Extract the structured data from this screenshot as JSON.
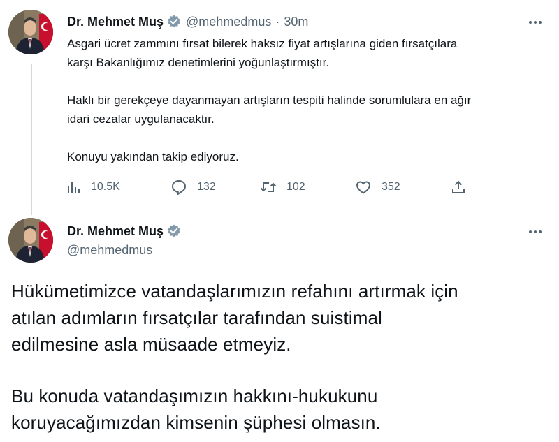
{
  "tweet1": {
    "author": {
      "name": "Dr. Mehmet Muş",
      "handle": "@mehmedmus",
      "verified": true
    },
    "separator": "·",
    "time": "30m",
    "paragraphs": [
      [
        "Asgari ücret zammını fırsat bilerek haksız fiyat artışlarına giden fırsatçılara",
        "karşı Bakanlığımız denetimlerini yoğunlaştırmıştır."
      ],
      [
        "Haklı bir gerekçeye dayanmayan artışların tespiti halinde sorumlulara en ağır",
        "idari cezalar uygulanacaktır."
      ],
      [
        "Konuyu yakından takip ediyoruz."
      ]
    ],
    "stats": {
      "views": "10.5K",
      "replies": "132",
      "retweets": "102",
      "likes": "352"
    },
    "icons": {
      "views": "views-chart-icon",
      "reply": "reply-bubble-icon",
      "retweet": "retweet-arrows-icon",
      "like": "heart-icon",
      "share": "share-upload-icon",
      "more": "more-dots-icon"
    }
  },
  "tweet2": {
    "author": {
      "name": "Dr. Mehmet Muş",
      "handle": "@mehmedmus",
      "verified": true
    },
    "paragraphs": [
      [
        "Hükümetimizce vatandaşlarımızın refahını artırmak için",
        "atılan adımların fırsatçılar tarafından suistimal",
        "edilmesine asla müsaade etmeyiz."
      ],
      [
        "Bu konuda vatandaşımızın hakkını-hukukunu",
        "koruyacağımızdan kimsenin şüphesi olmasın."
      ]
    ]
  },
  "colors": {
    "text": "#0f1419",
    "secondary": "#536471",
    "verified": "#829aab",
    "thread_line": "#cfd9de"
  }
}
